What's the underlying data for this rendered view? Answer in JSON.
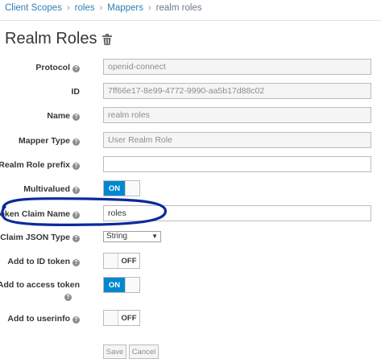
{
  "breadcrumb": [
    "Client Scopes",
    "roles",
    "Mappers",
    "realm roles"
  ],
  "title": "Realm Roles",
  "fields": {
    "protocol": {
      "label": "Protocol",
      "value": "openid-connect"
    },
    "id": {
      "label": "ID",
      "value": "7ff66e17-8e99-4772-9990-aa5b17d88c02"
    },
    "name": {
      "label": "Name",
      "value": "realm roles"
    },
    "mapper_type": {
      "label": "Mapper Type",
      "value": "User Realm Role"
    },
    "realm_role_prefix": {
      "label": "Realm Role prefix",
      "value": ""
    },
    "multivalued": {
      "label": "Multivalued",
      "state": "ON"
    },
    "token_claim_name": {
      "label": "Token Claim Name",
      "value": "roles"
    },
    "claim_json_type": {
      "label": "Claim JSON Type",
      "value": "String"
    },
    "add_to_id_token": {
      "label": "Add to ID token",
      "state": "OFF"
    },
    "add_to_access_token": {
      "label_line1": "Add to access token",
      "state": "ON"
    },
    "add_to_userinfo": {
      "label": "Add to userinfo",
      "state": "OFF"
    }
  },
  "help_glyph": "?",
  "buttons": {
    "save": "Save",
    "cancel": "Cancel"
  },
  "colors": {
    "toggle_on": "#0088ce",
    "annotation": "#0a2a9a",
    "link": "#2e7eb6"
  }
}
